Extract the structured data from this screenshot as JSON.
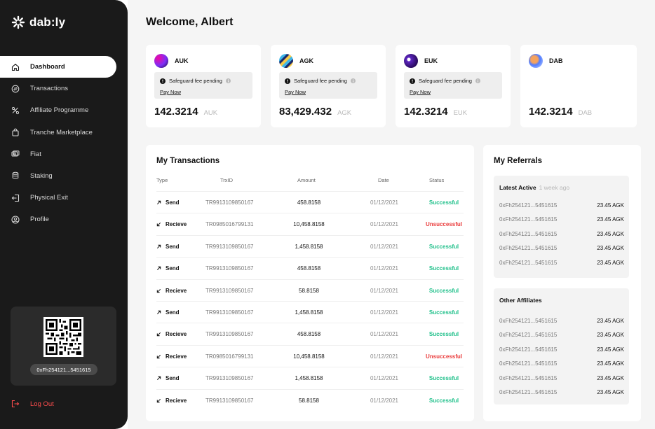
{
  "app": {
    "logo_text": "dab:ly",
    "logo_color": "#ffffff"
  },
  "sidebar": {
    "items": [
      {
        "label": "Dashboard",
        "icon": "home-icon",
        "active": true
      },
      {
        "label": "Transactions",
        "icon": "transactions-icon",
        "active": false
      },
      {
        "label": "Affiliate Programme",
        "icon": "affiliate-icon",
        "active": false
      },
      {
        "label": "Tranche Marketplace",
        "icon": "shopping-bag-icon",
        "active": false
      },
      {
        "label": "Fiat",
        "icon": "fiat-icon",
        "active": false
      },
      {
        "label": "Staking",
        "icon": "stack-icon",
        "active": false
      },
      {
        "label": "Physical Exit",
        "icon": "exit-icon",
        "active": false
      },
      {
        "label": "Profile",
        "icon": "profile-icon",
        "active": false
      }
    ],
    "wallet_address": "0xFh254121...5451615",
    "logout_label": "Log Out"
  },
  "header": {
    "welcome": "Welcome, Albert"
  },
  "tokens": [
    {
      "symbol": "AUK",
      "fee_text": "Safeguard fee pending",
      "pay_label": "Pay Now",
      "amount": "142.3214",
      "unit": "AUK",
      "has_fee": true,
      "logo_colors": [
        "#7b2ff7",
        "#f107a3"
      ]
    },
    {
      "symbol": "AGK",
      "fee_text": "Safeguard fee pending",
      "pay_label": "Pay Now",
      "amount": "83,429.432",
      "unit": "AGK",
      "has_fee": true,
      "logo_colors": [
        "#f7c948",
        "#3fb6e8"
      ]
    },
    {
      "symbol": "EUK",
      "fee_text": "Safeguard fee pending",
      "pay_label": "Pay Now",
      "amount": "142.3214",
      "unit": "EUK",
      "has_fee": true,
      "logo_colors": [
        "#3a1c71",
        "#5d26c1"
      ]
    },
    {
      "symbol": "DAB",
      "fee_text": "",
      "pay_label": "",
      "amount": "142.3214",
      "unit": "DAB",
      "has_fee": false,
      "logo_colors": [
        "#f5a25d",
        "#4f7cff"
      ]
    }
  ],
  "transactions": {
    "title": "My Transactions",
    "columns": {
      "type": "Type",
      "trxid": "TrxID",
      "amount": "Amount",
      "date": "Date",
      "status": "Status"
    },
    "rows": [
      {
        "type": "Send",
        "dir": "out",
        "trxid": "TR9913109850167",
        "amount": "458.8158",
        "date": "01/12/2021",
        "status": "Successful",
        "ok": true
      },
      {
        "type": "Recieve",
        "dir": "in",
        "trxid": "TR0985016799131",
        "amount": "10,458.8158",
        "date": "01/12/2021",
        "status": "Unsuccessful",
        "ok": false
      },
      {
        "type": "Send",
        "dir": "out",
        "trxid": "TR9913109850167",
        "amount": "1,458.8158",
        "date": "01/12/2021",
        "status": "Successful",
        "ok": true
      },
      {
        "type": "Send",
        "dir": "out",
        "trxid": "TR9913109850167",
        "amount": "458.8158",
        "date": "01/12/2021",
        "status": "Successful",
        "ok": true
      },
      {
        "type": "Recieve",
        "dir": "in",
        "trxid": "TR9913109850167",
        "amount": "58.8158",
        "date": "01/12/2021",
        "status": "Successful",
        "ok": true
      },
      {
        "type": "Send",
        "dir": "out",
        "trxid": "TR9913109850167",
        "amount": "1,458.8158",
        "date": "01/12/2021",
        "status": "Successful",
        "ok": true
      },
      {
        "type": "Recieve",
        "dir": "in",
        "trxid": "TR9913109850167",
        "amount": "458.8158",
        "date": "01/12/2021",
        "status": "Successful",
        "ok": true
      },
      {
        "type": "Recieve",
        "dir": "in",
        "trxid": "TR0985016799131",
        "amount": "10,458.8158",
        "date": "01/12/2021",
        "status": "Unsuccessful",
        "ok": false
      },
      {
        "type": "Send",
        "dir": "out",
        "trxid": "TR9913109850167",
        "amount": "1,458.8158",
        "date": "01/12/2021",
        "status": "Successful",
        "ok": true
      },
      {
        "type": "Recieve",
        "dir": "in",
        "trxid": "TR9913109850167",
        "amount": "58.8158",
        "date": "01/12/2021",
        "status": "Successful",
        "ok": true
      }
    ]
  },
  "referrals": {
    "title": "My Referrals",
    "latest": {
      "title": "Latest Active",
      "subtitle": "1 week ago",
      "rows": [
        {
          "address": "0xFh254121...5451615",
          "value": "23.45 AGK"
        },
        {
          "address": "0xFh254121...5451615",
          "value": "23.45 AGK"
        },
        {
          "address": "0xFh254121...5451615",
          "value": "23.45 AGK"
        },
        {
          "address": "0xFh254121...5451615",
          "value": "23.45 AGK"
        },
        {
          "address": "0xFh254121...5451615",
          "value": "23.45 AGK"
        }
      ]
    },
    "other": {
      "title": "Other Affiliates",
      "rows": [
        {
          "address": "0xFh254121...5451615",
          "value": "23.45 AGK"
        },
        {
          "address": "0xFh254121...5451615",
          "value": "23.45 AGK"
        },
        {
          "address": "0xFh254121...5451615",
          "value": "23.45 AGK"
        },
        {
          "address": "0xFh254121...5451615",
          "value": "23.45 AGK"
        },
        {
          "address": "0xFh254121...5451615",
          "value": "23.45 AGK"
        },
        {
          "address": "0xFh254121...5451615",
          "value": "23.45 AGK"
        }
      ]
    }
  },
  "colors": {
    "success": "#21c08b",
    "danger": "#ea3b3b",
    "logout": "#ff4d4d",
    "sidebar_bg": "#1a1a1a",
    "page_bg": "#f5f5f5"
  }
}
